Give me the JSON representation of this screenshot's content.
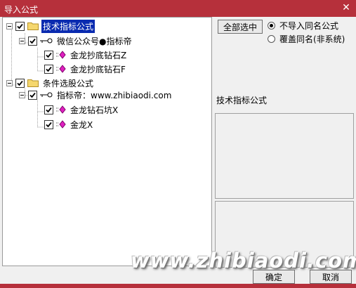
{
  "window": {
    "title": "导入公式",
    "close_glyph": "✕"
  },
  "tree": {
    "nodes": [
      {
        "id": "n1",
        "label": "技术指标公式",
        "type": "folder",
        "checked": true,
        "selected": true
      },
      {
        "id": "n2",
        "label": "微信公众号●指标帝",
        "type": "group",
        "checked": true
      },
      {
        "id": "n3",
        "label": "金龙抄底钻石Z",
        "type": "formula",
        "checked": true
      },
      {
        "id": "n4",
        "label": "金龙抄底钻石F",
        "type": "formula",
        "checked": true
      },
      {
        "id": "n5",
        "label": "条件选股公式",
        "type": "folder",
        "checked": true
      },
      {
        "id": "n6",
        "label": "指标帝：www.zhibiaodi.com",
        "type": "group",
        "checked": true
      },
      {
        "id": "n7",
        "label": "金龙钻石坑X",
        "type": "formula",
        "checked": true
      },
      {
        "id": "n8",
        "label": "金龙X",
        "type": "formula",
        "checked": true
      }
    ]
  },
  "right_panel": {
    "select_all_label": "全部选中",
    "options": [
      {
        "label": "不导入同名公式",
        "checked": true
      },
      {
        "label": "覆盖同名(非系统)",
        "checked": false
      }
    ],
    "info_label": "技术指标公式"
  },
  "buttons": {
    "ok_label": "确定",
    "cancel_label": "取消"
  },
  "watermark": "www.zhibiaodi.com",
  "colors": {
    "titlebar": "#b6303b",
    "selection": "#0a2bb0",
    "formula_icon": "#e020c0",
    "folder": "#f5d76e"
  }
}
